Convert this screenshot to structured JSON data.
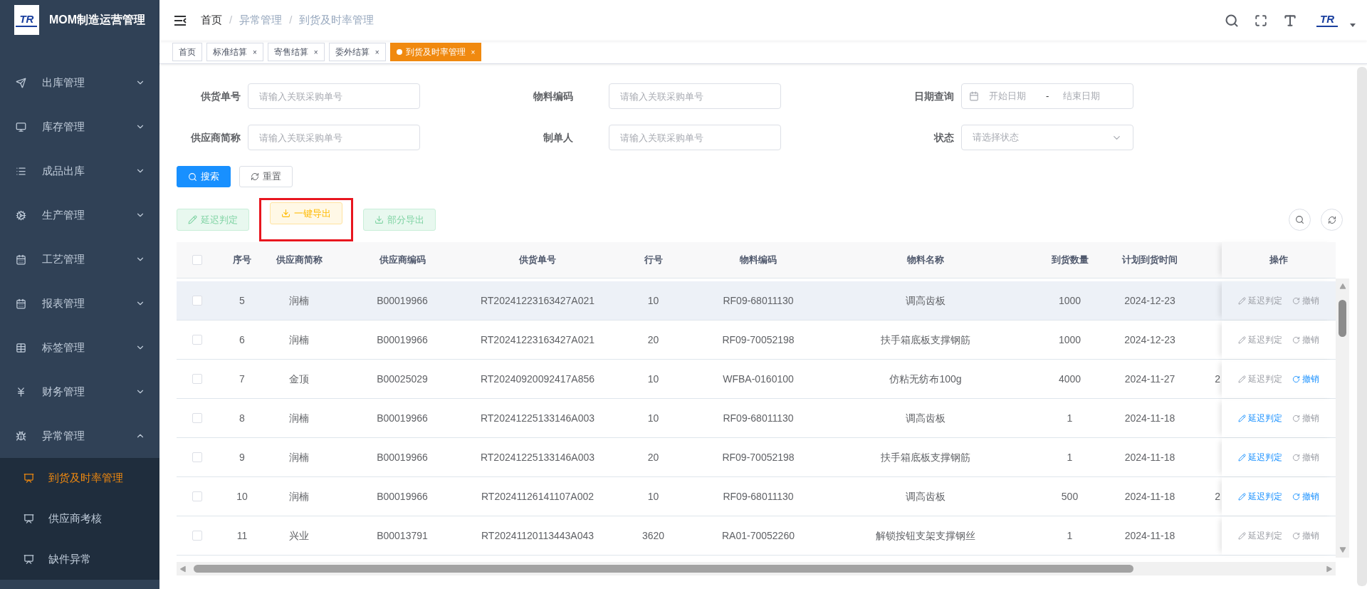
{
  "app": {
    "title": "MOM制造运营管理",
    "logo_text": "TR"
  },
  "sidebar": {
    "items": [
      {
        "label": "出库管理",
        "expanded": false
      },
      {
        "label": "库存管理",
        "expanded": false
      },
      {
        "label": "成品出库",
        "expanded": false
      },
      {
        "label": "生产管理",
        "expanded": false
      },
      {
        "label": "工艺管理",
        "expanded": false
      },
      {
        "label": "报表管理",
        "expanded": false
      },
      {
        "label": "标签管理",
        "expanded": false
      },
      {
        "label": "财务管理",
        "expanded": false
      },
      {
        "label": "异常管理",
        "expanded": true,
        "children": [
          {
            "label": "到货及时率管理",
            "selected": true
          },
          {
            "label": "供应商考核",
            "selected": false
          },
          {
            "label": "缺件异常",
            "selected": false
          }
        ]
      }
    ]
  },
  "breadcrumb": {
    "separator": "/",
    "items": [
      "首页",
      "异常管理",
      "到货及时率管理"
    ]
  },
  "header": {
    "avatar_text": "TR"
  },
  "tabs": [
    {
      "label": "首页",
      "selected": false
    },
    {
      "label": "标准结算",
      "selected": false,
      "close": "×"
    },
    {
      "label": "寄售结算",
      "selected": false,
      "close": "×"
    },
    {
      "label": "委外结算",
      "selected": false,
      "close": "×"
    },
    {
      "label": "到货及时率管理",
      "selected": true,
      "close": "×"
    }
  ],
  "filters": [
    {
      "label": "供货单号",
      "kind": "text",
      "placeholder": "请输入关联采购单号"
    },
    {
      "label": "物料编码",
      "kind": "text",
      "placeholder": "请输入关联采购单号"
    },
    {
      "label": "日期查询",
      "kind": "daterange",
      "start_placeholder": "开始日期",
      "separator": "-",
      "end_placeholder": "结束日期"
    },
    {
      "label": "供应商简称",
      "kind": "text",
      "placeholder": "请输入关联采购单号"
    },
    {
      "label": "制单人",
      "kind": "text",
      "placeholder": "请输入关联采购单号"
    },
    {
      "label": "状态",
      "kind": "select",
      "placeholder": "请选择状态"
    }
  ],
  "search_buttons": [
    {
      "label": "搜索",
      "kind": "primary"
    },
    {
      "label": "重置",
      "kind": "default"
    }
  ],
  "actions": [
    {
      "label": "延迟判定",
      "kind": "success",
      "highlighted": false
    },
    {
      "label": "一键导出",
      "kind": "warning",
      "highlighted": true
    },
    {
      "label": "部分导出",
      "kind": "export",
      "highlighted": false
    }
  ],
  "table": {
    "header_checked": false,
    "columns": [
      "序号",
      "供应商简称",
      "供应商编码",
      "供货单号",
      "行号",
      "物料编码",
      "物料名称",
      "到货数量",
      "计划到货时间"
    ],
    "actions_column": "操作",
    "rows": [
      {
        "checked": false,
        "highlighted": true,
        "cells": [
          "5",
          "润楠",
          "B00019966",
          "RT20241223163427A021",
          "10",
          "RF09-68011130",
          "调高齿板",
          "1000",
          "2024-12-23"
        ],
        "actions": [
          {
            "label": "延迟判定",
            "enabled": false
          },
          {
            "label": "撤销",
            "enabled": false
          }
        ]
      },
      {
        "checked": false,
        "highlighted": false,
        "cells": [
          "6",
          "润楠",
          "B00019966",
          "RT20241223163427A021",
          "20",
          "RF09-70052198",
          "扶手箱底板支撑钢筋",
          "1000",
          "2024-12-23"
        ],
        "actions": [
          {
            "label": "延迟判定",
            "enabled": false
          },
          {
            "label": "撤销",
            "enabled": false
          }
        ]
      },
      {
        "checked": false,
        "highlighted": false,
        "cells": [
          "7",
          "金顶",
          "B00025029",
          "RT20240920092417A856",
          "10",
          "WFBA-0160100",
          "仿粘无纺布100g",
          "4000",
          "2024-11-27"
        ],
        "column_10": "2",
        "actions": [
          {
            "label": "延迟判定",
            "enabled": false
          },
          {
            "label": "撤销",
            "enabled": true
          }
        ]
      },
      {
        "checked": false,
        "highlighted": false,
        "cells": [
          "8",
          "润楠",
          "B00019966",
          "RT20241225133146A003",
          "10",
          "RF09-68011130",
          "调高齿板",
          "1",
          "2024-11-18"
        ],
        "actions": [
          {
            "label": "延迟判定",
            "enabled": true
          },
          {
            "label": "撤销",
            "enabled": false
          }
        ]
      },
      {
        "checked": false,
        "highlighted": false,
        "cells": [
          "9",
          "润楠",
          "B00019966",
          "RT20241225133146A003",
          "20",
          "RF09-70052198",
          "扶手箱底板支撑钢筋",
          "1",
          "2024-11-18"
        ],
        "actions": [
          {
            "label": "延迟判定",
            "enabled": true
          },
          {
            "label": "撤销",
            "enabled": false
          }
        ]
      },
      {
        "checked": false,
        "highlighted": false,
        "cells": [
          "10",
          "润楠",
          "B00019966",
          "RT20241126141107A002",
          "10",
          "RF09-68011130",
          "调高齿板",
          "500",
          "2024-11-18"
        ],
        "column_10": "2",
        "actions": [
          {
            "label": "延迟判定",
            "enabled": true
          },
          {
            "label": "撤销",
            "enabled": true
          }
        ]
      },
      {
        "checked": false,
        "highlighted": false,
        "cells": [
          "11",
          "兴业",
          "B00013791",
          "RT20241120113443A043",
          "3620",
          "RA01-70052260",
          "解锁按钮支架支撑钢丝",
          "1",
          "2024-11-18"
        ],
        "actions": [
          {
            "label": "延迟判定",
            "enabled": false
          },
          {
            "label": "撤销",
            "enabled": false
          }
        ]
      }
    ]
  }
}
